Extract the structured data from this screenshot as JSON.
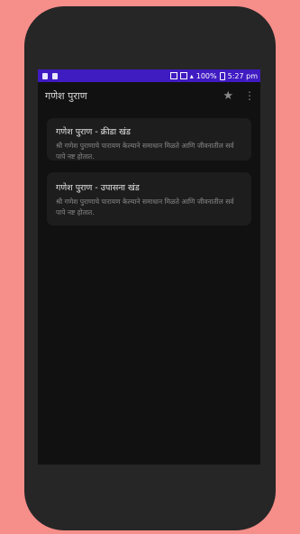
{
  "statusbar": {
    "battery": "100%",
    "time": "5:27 pm"
  },
  "appbar": {
    "title": "गणेश पुराण"
  },
  "items": [
    {
      "title": "गणेश पुराण - क्रीडा खंड",
      "description": "श्री गणेश पुराणाचे पारायण केल्याने समाधान मिळते आणि जीवनातील सर्व पापे नष्ट होतात."
    },
    {
      "title": "गणेश पुराण - उपासना खंड",
      "description": "श्री गणेश पुराणाचे पारायण केल्याने समाधान मिळते आणि जीवनातील सर्व पापे नष्ट होतात."
    }
  ],
  "icons": {
    "favorite": "star-icon",
    "menu": "more-vert-icon"
  },
  "colors": {
    "statusbar": "#3f1bc2",
    "background_outer": "#f68e8a",
    "screen": "#111111",
    "card": "#1d1d1d"
  }
}
